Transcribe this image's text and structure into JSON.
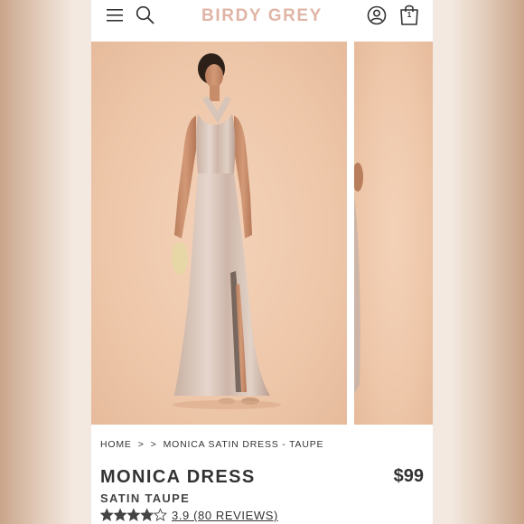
{
  "header": {
    "brand": "BIRDY GREY",
    "bag_count": "1",
    "icons": [
      "menu-icon",
      "search-icon",
      "account-icon",
      "bag-icon"
    ]
  },
  "breadcrumb": {
    "items": [
      "HOME",
      ">",
      ">",
      "MONICA SATIN DRESS - TAUPE"
    ]
  },
  "product": {
    "title": "MONICA DRESS",
    "price": "$99",
    "color": "SATIN TAUPE",
    "rating": 3.9,
    "rating_max": 5,
    "reviews_label": "3.9 (80 REVIEWS)"
  },
  "colors": {
    "brand": "#e0b5a6",
    "text": "#333333",
    "photo_bg": "#efc8ab",
    "dress": "#d7c2b6"
  }
}
